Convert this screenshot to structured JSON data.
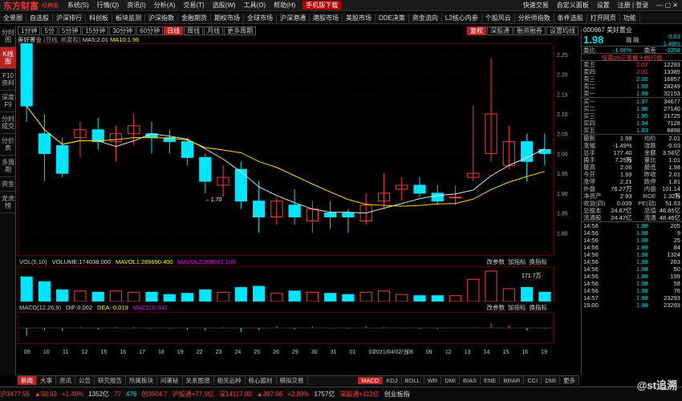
{
  "app": {
    "logo": "东方财富",
    "edition": "经典版",
    "download": "手机版下载",
    "user": "注册 | 登录"
  },
  "menu": [
    "系统(S)",
    "行情(Q)",
    "资讯(I)",
    "分析(A)",
    "交易(T)",
    "选股(W)",
    "工具(O)",
    "帮助(H)"
  ],
  "menu_right": [
    "快速交易",
    "自定义面板",
    "设置",
    "注册",
    "登录"
  ],
  "nav": [
    "全景图",
    "自选股",
    "沪深排行",
    "科创板",
    "板块监测",
    "沪深指数",
    "金融期货",
    "期权市场",
    "全球市场",
    "沪深港通",
    "港股市场",
    "美股市场",
    "DDE决策",
    "资金流向",
    "L2核心内参",
    "个股风云",
    "分析师指数",
    "条件选股",
    "打开网页",
    "功能"
  ],
  "leftbar": [
    "分时图",
    "K线图",
    "F10资料",
    "深度F9",
    "分时成交",
    "分价表",
    "多周期",
    "资金",
    "龙虎榜"
  ],
  "period": [
    "1分钟",
    "5分",
    "5分钟",
    "15分钟",
    "30分钟",
    "60分钟",
    "日线",
    "周线",
    "月线",
    "更多周期"
  ],
  "period_right": [
    "复权",
    "深股通",
    "融资融券",
    "设置均线"
  ],
  "chart_header": {
    "name": "美好置业",
    "mode": "(日线, 前复权)",
    "ma5": "MA5:2.01",
    "ma10": "MA10:1.96"
  },
  "chart_data": {
    "type": "candlestick",
    "x": [
      "03-08",
      "03-09",
      "03-10",
      "03-11",
      "03-12",
      "03-15",
      "03-16",
      "03-17",
      "03-18",
      "03-19",
      "03-22",
      "03-23",
      "03-24",
      "03-25",
      "03-26",
      "03-29",
      "03-30",
      "03-31",
      "04-01",
      "04-02",
      "04-06",
      "04-07",
      "04-08",
      "04-09",
      "04-12",
      "04-13",
      "04-14",
      "04-15",
      "04-16",
      "04-19"
    ],
    "open": [
      2.28,
      2.05,
      2.02,
      2.04,
      2.06,
      2.03,
      2.05,
      2.05,
      2.04,
      2.03,
      1.99,
      1.92,
      1.96,
      1.88,
      1.84,
      1.87,
      1.83,
      1.85,
      1.85,
      1.83,
      1.88,
      1.91,
      1.92,
      1.9,
      1.89,
      1.94,
      2.0,
      1.97,
      2.03,
      2.01
    ],
    "close": [
      2.12,
      2.0,
      1.95,
      2.06,
      2.03,
      2.05,
      2.07,
      2.04,
      2.03,
      1.99,
      1.93,
      1.94,
      1.88,
      1.84,
      1.88,
      1.84,
      1.86,
      1.84,
      1.84,
      1.87,
      1.9,
      1.92,
      1.9,
      1.88,
      1.89,
      1.95,
      2.1,
      2.03,
      1.98,
      2.0
    ],
    "high": [
      2.29,
      2.1,
      2.04,
      2.08,
      2.09,
      2.07,
      2.1,
      2.08,
      2.06,
      2.04,
      2.0,
      1.97,
      1.98,
      1.93,
      1.89,
      1.91,
      1.88,
      1.88,
      1.86,
      1.9,
      1.95,
      1.94,
      1.94,
      1.92,
      1.92,
      2.12,
      2.24,
      2.07,
      2.05,
      2.05
    ],
    "low": [
      2.08,
      1.93,
      1.94,
      1.99,
      2.01,
      1.98,
      2.02,
      2.0,
      2.0,
      1.97,
      1.9,
      1.89,
      1.86,
      1.8,
      1.82,
      1.82,
      1.8,
      1.81,
      1.8,
      1.82,
      1.86,
      1.88,
      1.89,
      1.87,
      1.87,
      1.93,
      1.98,
      1.96,
      1.93,
      1.97
    ],
    "ylim": [
      1.75,
      2.27
    ],
    "yticks": [
      2.25,
      2.2,
      2.15,
      2.1,
      2.05,
      2.0,
      1.95,
      1.9,
      1.85,
      1.8
    ],
    "xticks": [
      "09",
      "10",
      "11",
      "12",
      "15",
      "16",
      "17",
      "18",
      "19",
      "22",
      "23",
      "24",
      "25",
      "26",
      "29",
      "30",
      "31",
      "01",
      "02",
      "2021/04/02/五",
      "08",
      "09",
      "12",
      "13",
      "14",
      "15",
      "16",
      "19"
    ],
    "annotations": [
      {
        "label": "2.29"
      },
      {
        "label": "1.70"
      }
    ]
  },
  "volume": {
    "label": "VOL(5,10)",
    "v": "VOLUME:174038.000",
    "m1": "MAVOL1:289690.400",
    "m2": "MAVOL2:208681.100",
    "unit": "171.7万",
    "buttons": [
      "改参数",
      "加指标",
      "换指标"
    ]
  },
  "macd": {
    "label": "MACD(12,26,9)",
    "dif": "DIF:0.002",
    "dea": "DEA:-0.019",
    "macd": "MACD:0.042",
    "buttons": [
      "改参数",
      "加指标",
      "换指标"
    ]
  },
  "bottomtabs": [
    "指标",
    "教我看图",
    "成交量",
    "均线",
    "资金博弈[L2]",
    "资金趋势[L2]",
    "深股通持股变化",
    "两融数据",
    "MACD",
    "KDJ",
    "BOLL",
    "WR",
    "DMI",
    "BIAS",
    "ENE",
    "BRAR",
    "CCI",
    "DMI",
    "更多"
  ],
  "bottomtabs2": [
    "新闻",
    "大事",
    "资讯",
    "公告",
    "研究报告",
    "所属板块",
    "问董秘",
    "关系图谱",
    "相关品种",
    "核心题材",
    "模拟交易"
  ],
  "quote": {
    "code": "000667",
    "name": "美好置业",
    "price": "1.98",
    "tags": "融  融",
    "chg": "-0.03",
    "pct": "-1.49%",
    "rate_label": "委比",
    "rate": "-1.66%",
    "diff_label": "委差",
    "diff": "-3358",
    "promo": "仅需20元查看十档行情",
    "asks": [
      [
        "卖五",
        "2.02",
        "12283"
      ],
      [
        "卖四",
        "2.01",
        "13385"
      ],
      [
        "卖三",
        "2.00",
        "16857"
      ],
      [
        "卖二",
        "1.99",
        "28249"
      ],
      [
        "卖一",
        "1.98",
        "32153"
      ]
    ],
    "bids": [
      [
        "买一",
        "1.97",
        "34677"
      ],
      [
        "买二",
        "1.96",
        "27140"
      ],
      [
        "买三",
        "1.95",
        "21725"
      ],
      [
        "买四",
        "1.94",
        "7128"
      ],
      [
        "买五",
        "1.93",
        "8898"
      ]
    ],
    "stats": [
      [
        "最新",
        "1.98",
        "均价",
        "2.01"
      ],
      [
        "涨幅",
        "-1.49%",
        "涨跌",
        "-0.03"
      ],
      [
        "总手",
        "177.40万",
        "金额",
        "3.56亿"
      ],
      [
        "换手",
        "7.25%",
        "量比",
        "1.01"
      ],
      [
        "最高",
        "2.06",
        "最低",
        "1.98"
      ],
      [
        "今开",
        "1.99",
        "昨收",
        "2.01"
      ],
      [
        "涨停",
        "2.21",
        "跌停",
        "1.81"
      ],
      [
        "外盘",
        "76.27万",
        "内盘",
        "101.14万"
      ],
      [
        "净资产",
        "2.93",
        "ROE",
        "1.32%"
      ],
      [
        "收益(四)",
        "0.039",
        "PE(动)",
        "51.63"
      ],
      [
        "总股本",
        "24.67亿",
        "总值",
        "48.85亿"
      ],
      [
        "流通股",
        "24.47亿",
        "流通",
        "48.46亿"
      ]
    ],
    "ticks": [
      [
        "14:56",
        "1.98",
        "205"
      ],
      [
        "14:56",
        "1.98",
        "9"
      ],
      [
        "14:56",
        "1.98",
        "25"
      ],
      [
        "14:56",
        "1.98",
        "84"
      ],
      [
        "14:56",
        "1.98",
        "1324"
      ],
      [
        "14:56",
        "1.98",
        "263"
      ],
      [
        "14:56",
        "1.98",
        "50"
      ],
      [
        "14:56",
        "1.98",
        "199"
      ],
      [
        "14:56",
        "1.98",
        "58"
      ],
      [
        "14:56",
        "1.98",
        "76"
      ],
      [
        "14:57",
        "1.98",
        "23293"
      ],
      [
        "15:00",
        "1.98",
        "23293"
      ]
    ]
  },
  "status": [
    [
      "沪",
      "3477.55",
      "red"
    ],
    [
      "▲",
      "50.93",
      "red"
    ],
    [
      "+1.49%",
      "",
      "red"
    ],
    [
      "1352",
      "亿",
      "wht"
    ],
    [
      "77",
      "",
      "red"
    ],
    [
      "476",
      "",
      "grn"
    ],
    [
      "创",
      "3604.7",
      "red"
    ],
    [
      "沪股通",
      "+77.9亿",
      "red"
    ],
    [
      "深",
      "14117.80",
      "red"
    ],
    [
      "▲",
      "397.06",
      "red"
    ],
    [
      "+2.89%",
      "",
      "red"
    ],
    [
      "1757",
      "亿",
      "wht"
    ],
    [
      "深股通",
      "+113亿",
      "red"
    ],
    [
      "创业板指",
      "",
      "wht"
    ]
  ],
  "watermark": "@st追溯"
}
